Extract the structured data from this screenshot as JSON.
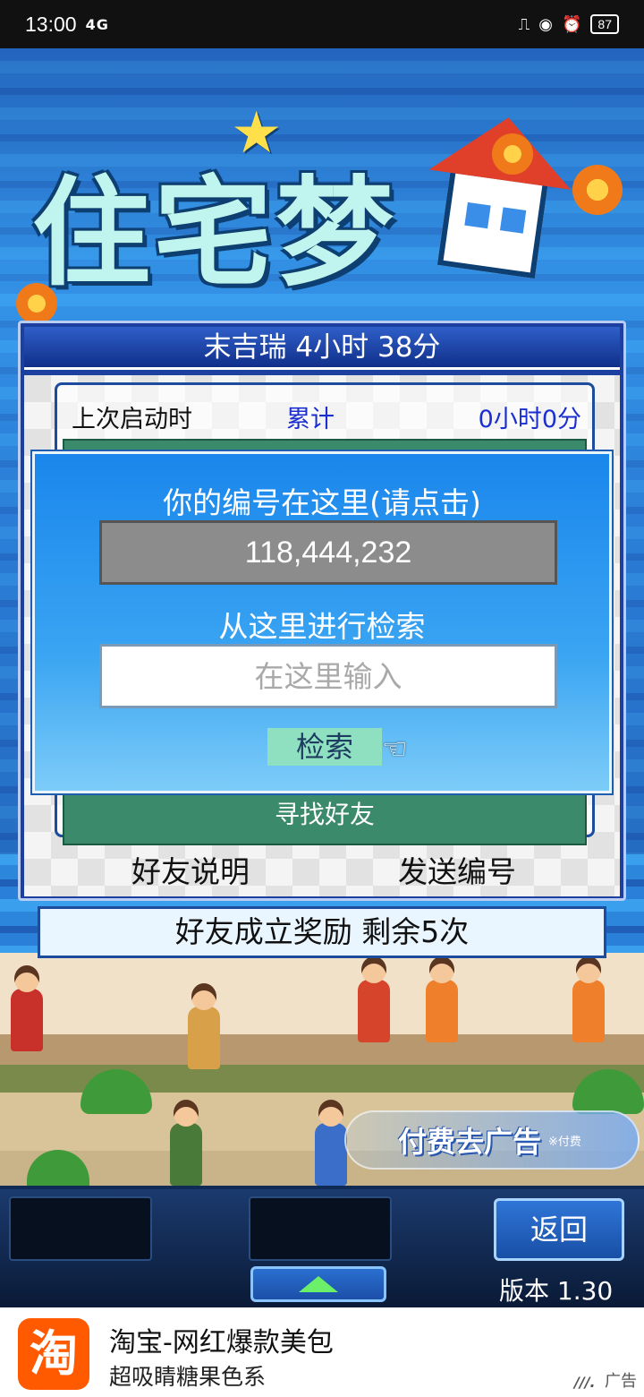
{
  "status_bar": {
    "time": "13:00",
    "signal_text": "4G",
    "battery": "87"
  },
  "game": {
    "logo_text": "住宅梦",
    "no_ads_button": "付费去广告",
    "no_ads_note": "※付费"
  },
  "friend_panel": {
    "header": "末吉瑞  4小时 38分",
    "last_launch_label": "上次启动时",
    "total_label": "累计",
    "total_value": "0小时0分",
    "find_friends_label": "寻找好友",
    "friend_help_button": "好友说明",
    "send_id_button": "发送编号",
    "reward_text": "好友成立奖励  剩余5次"
  },
  "id_dialog": {
    "title": "你的编号在这里(请点击)",
    "player_id": "118,444,232",
    "search_label": "从这里进行检索",
    "search_placeholder": "在这里输入",
    "search_button": "检索"
  },
  "controls": {
    "back_button": "返回",
    "version": "版本 1.30"
  },
  "ad": {
    "logo_char": "淘",
    "title": "淘宝-网红爆款美包",
    "subtitle": "超吸睛糖果色系",
    "tag": "广告"
  },
  "colors": {
    "dialog_blue": "#1a86ec",
    "panel_blue": "#1c3fa0",
    "list_green": "#3c8a6c",
    "search_button_green": "#8fe0c0",
    "ad_orange": "#ff5a00"
  }
}
